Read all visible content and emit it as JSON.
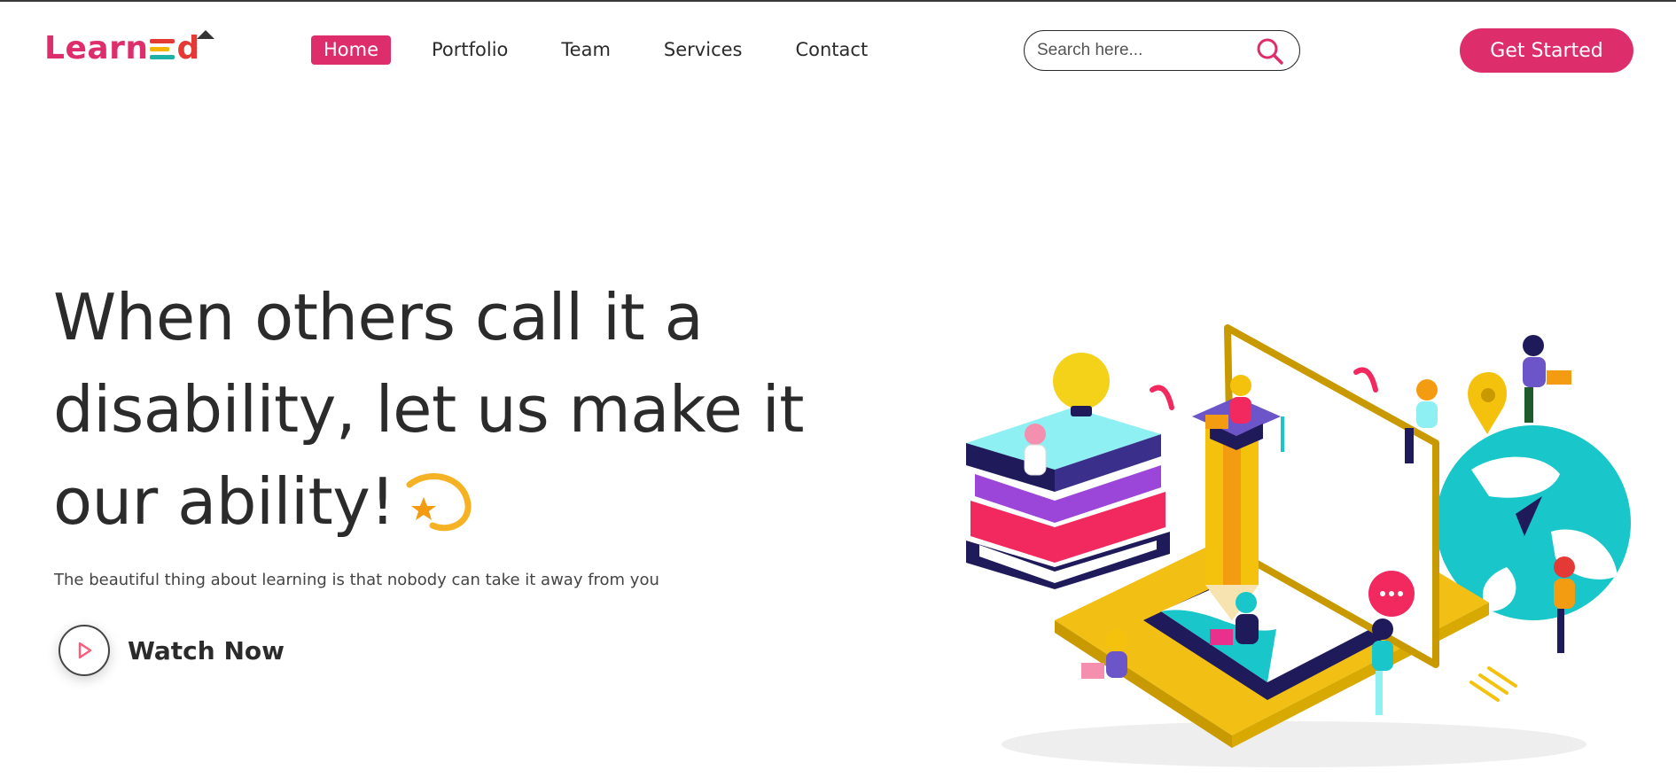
{
  "brand": {
    "logo_text": "Learned",
    "colors": {
      "primary": "#dd2e6b",
      "text": "#2b2b2b",
      "accent_yellow": "#f4c20d",
      "accent_teal": "#19c6c9",
      "accent_navy": "#1f1a5a"
    }
  },
  "nav": {
    "items": [
      {
        "label": "Home",
        "active": true
      },
      {
        "label": "Portfolio",
        "active": false
      },
      {
        "label": "Team",
        "active": false
      },
      {
        "label": "Services",
        "active": false
      },
      {
        "label": "Contact",
        "active": false
      }
    ]
  },
  "search": {
    "placeholder": "Search here...",
    "icon": "search-icon"
  },
  "header": {
    "cta_label": "Get Started"
  },
  "hero": {
    "headline_lines": [
      "When others call it a",
      "disability, let us make it",
      "our ability!"
    ],
    "headline_icon": "dizzy-sparkle-icon",
    "subtitle": "The beautiful thing about learning is that nobody can take it away from you",
    "watch_label": "Watch Now",
    "watch_icon": "play-icon",
    "illustration": "online-learning-illustration"
  }
}
